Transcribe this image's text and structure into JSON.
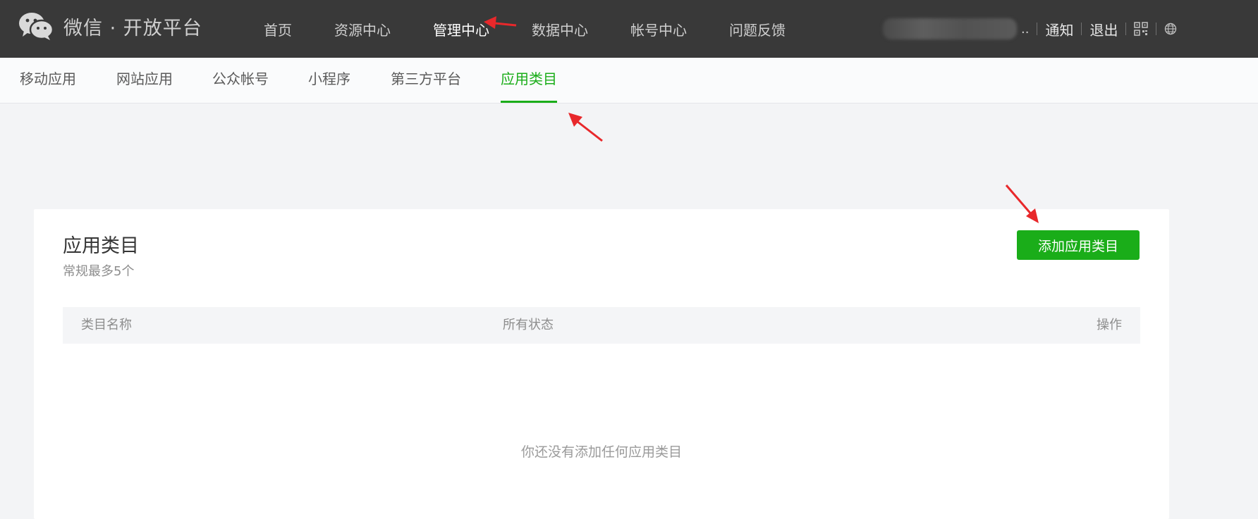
{
  "brand": {
    "name": "微信 · 开放平台",
    "logo_icon": "wechat-logo-icon"
  },
  "main_nav": [
    {
      "label": "首页",
      "active": false
    },
    {
      "label": "资源中心",
      "active": false
    },
    {
      "label": "管理中心",
      "active": true
    },
    {
      "label": "数据中心",
      "active": false
    },
    {
      "label": "帐号中心",
      "active": false
    },
    {
      "label": "问题反馈",
      "active": false
    }
  ],
  "user": {
    "name_suffix": ".."
  },
  "top_links": {
    "notify": "通知",
    "logout": "退出"
  },
  "sub_nav": [
    {
      "label": "移动应用",
      "active": false
    },
    {
      "label": "网站应用",
      "active": false
    },
    {
      "label": "公众帐号",
      "active": false
    },
    {
      "label": "小程序",
      "active": false
    },
    {
      "label": "第三方平台",
      "active": false
    },
    {
      "label": "应用类目",
      "active": true
    }
  ],
  "card": {
    "title": "应用类目",
    "subtitle": "常规最多5个",
    "add_button": "添加应用类目",
    "columns": [
      "类目名称",
      "所有状态",
      "操作"
    ],
    "empty_text": "你还没有添加任何应用类目"
  },
  "colors": {
    "accent": "#1aad19",
    "topbar": "#393939",
    "annotation": "#e8282b"
  }
}
